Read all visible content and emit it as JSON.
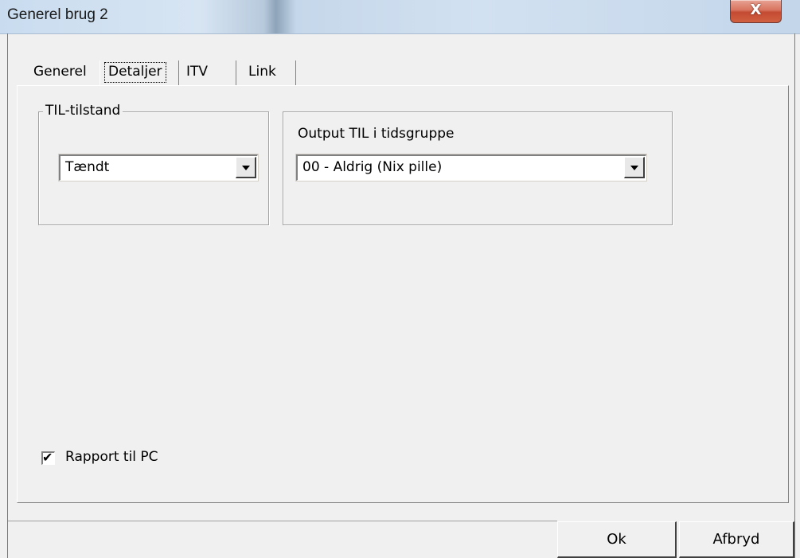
{
  "window": {
    "title": "Generel brug 2",
    "close_glyph": "X"
  },
  "tabs": [
    {
      "label": "Generel",
      "active": false
    },
    {
      "label": "Detaljer",
      "active": true
    },
    {
      "label": "ITV",
      "active": false
    },
    {
      "label": "Link",
      "active": false
    }
  ],
  "til_group": {
    "title": "TIL-tilstand",
    "select_value": "Tændt"
  },
  "output_group": {
    "label": "Output TIL i tidsgruppe",
    "select_value": "00 - Aldrig (Nix pille)"
  },
  "report": {
    "label": "Rapport til PC",
    "checked": true,
    "check_glyph": "✔"
  },
  "buttons": {
    "ok": "Ok",
    "cancel": "Afbryd"
  }
}
